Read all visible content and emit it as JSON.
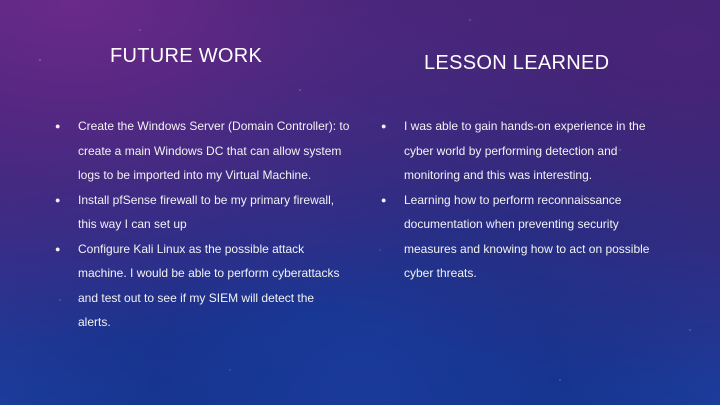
{
  "left": {
    "heading": "FUTURE WORK",
    "items": [
      "Create the Windows Server (Domain Controller): to create a main Windows DC that can allow system logs to be imported into my Virtual Machine.",
      "Install pfSense firewall to be my primary firewall, this way I can set up",
      "Configure Kali Linux as the possible attack machine. I would be able to perform cyberattacks and test out to see if my SIEM will detect the alerts."
    ]
  },
  "right": {
    "heading": "LESSON LEARNED",
    "items": [
      "I was able to gain hands-on experience in the cyber world by performing detection and monitoring and this was interesting.",
      "Learning how to perform reconnaissance documentation when preventing security measures and knowing how to act on possible cyber threats."
    ]
  },
  "bullet_glyph": "●"
}
